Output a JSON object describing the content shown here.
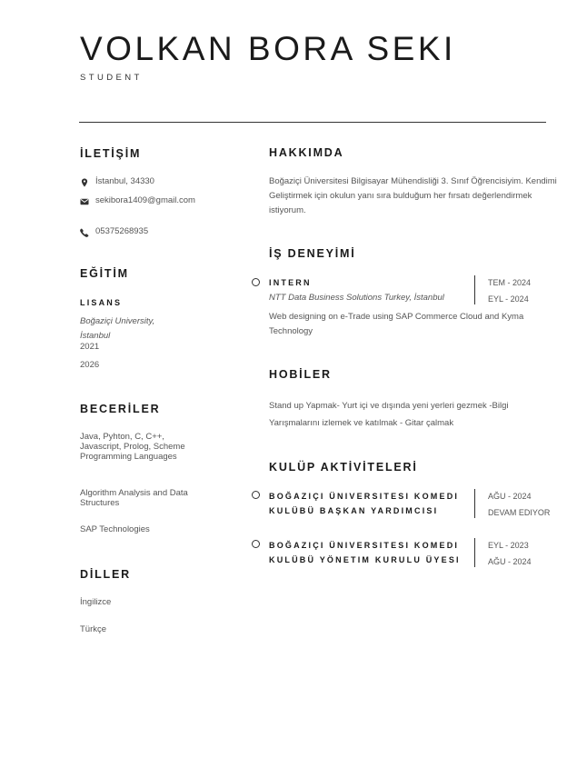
{
  "header": {
    "name": "VOLKAN BORA SEKI",
    "title": "STUDENT"
  },
  "contact": {
    "heading": "İLETİŞİM",
    "location": "İstanbul, 34330",
    "email": "sekibora1409@gmail.com",
    "phone": "05375268935"
  },
  "education": {
    "heading": "EĞİTİM",
    "degree": "LISANS",
    "school": "Boğaziçi University, İstanbul",
    "start": "2021",
    "end": "2026"
  },
  "skills": {
    "heading": "BECERİLER",
    "items": [
      "Java, Pyhton, C, C++, Javascript, Prolog, Scheme Programming Languages",
      "Algorithm Analysis and Data Structures",
      "SAP Technologies"
    ]
  },
  "languages": {
    "heading": "DİLLER",
    "items": [
      "İngilizce",
      "Türkçe"
    ]
  },
  "about": {
    "heading": "HAKKIMDA",
    "text": "Boğaziçi Üniversitesi Bilgisayar Mühendisliği 3. Sınıf Öğrencisiyim. Kendimi Geliştirmek için okulun yanı sıra bulduğum her fırsatı değerlendirmek istiyorum."
  },
  "experience": {
    "heading": "İŞ DENEYİMİ",
    "items": [
      {
        "title": "INTERN",
        "company": "NTT Data Business Solutions Turkey, İstanbul",
        "start": "TEM - 2024",
        "end": "EYL - 2024",
        "description": "Web designing on e-Trade using SAP Commerce Cloud and Kyma Technology"
      }
    ]
  },
  "hobbies": {
    "heading": "HOBİLER",
    "text": "Stand up Yapmak- Yurt içi ve dışında yeni yerleri gezmek -Bilgi Yarışmalarını izlemek ve katılmak - Gitar çalmak"
  },
  "clubs": {
    "heading": "KULÜP AKTİVİTELERİ",
    "items": [
      {
        "line1": "BOĞAZIÇI ÜNIVERSITESI KOMEDI",
        "line2": "KULÜBÜ BAŞKAN YARDIMCISI",
        "start": "AĞU - 2024",
        "end": "DEVAM EDIYOR"
      },
      {
        "line1": "BOĞAZIÇI ÜNIVERSITESI KOMEDI",
        "line2": "KULÜBÜ YÖNETIM KURULU ÜYESI",
        "start": "EYL - 2023",
        "end": "AĞU - 2024"
      }
    ]
  }
}
